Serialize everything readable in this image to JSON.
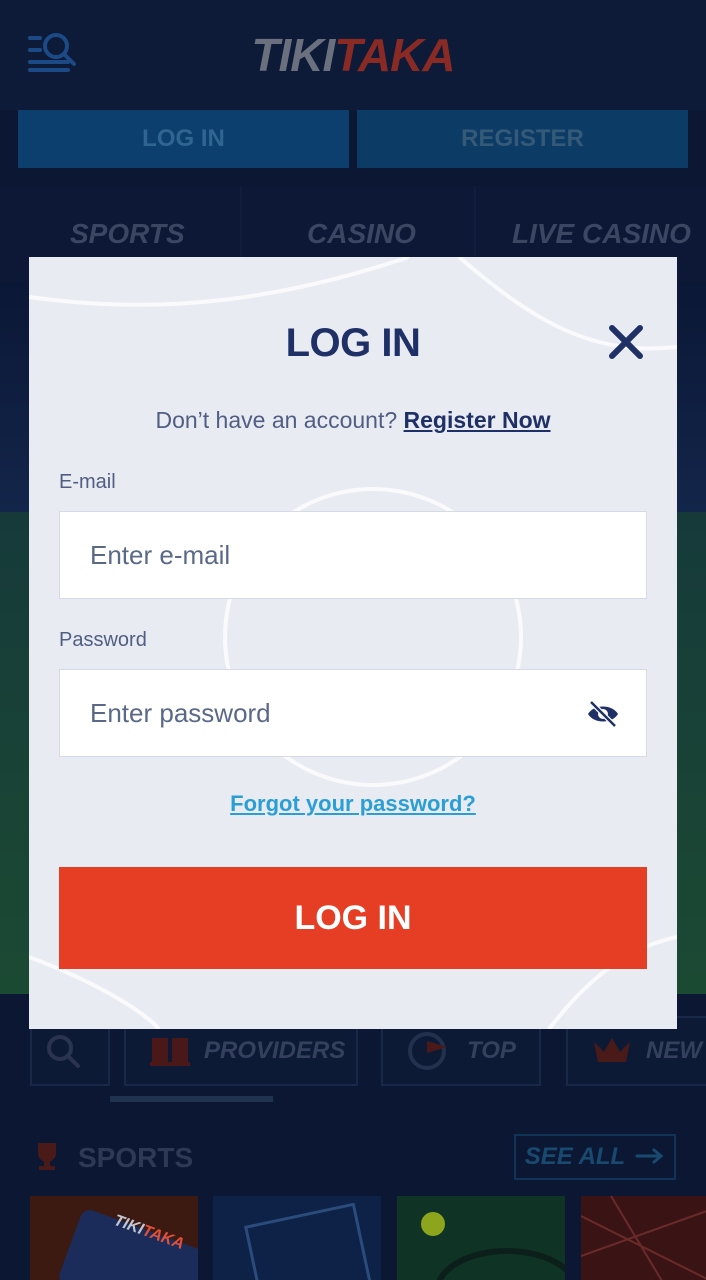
{
  "header": {
    "logo_part1": "TIKI",
    "logo_part2": "TAKA",
    "login_label": "LOG IN",
    "register_label": "REGISTER"
  },
  "categories": [
    "SPORTS",
    "CASINO",
    "LIVE CASINO"
  ],
  "chips": {
    "providers": "PROVIDERS",
    "top": "TOP",
    "new": "NEW"
  },
  "sports_section": {
    "title": "SPORTS",
    "see_all": "SEE ALL"
  },
  "card_logo": {
    "part1": "TIKI",
    "part2": "TAKA"
  },
  "modal": {
    "title": "LOG IN",
    "register_prompt": "Don’t have an account?",
    "register_link": "Register Now",
    "email_label": "E-mail",
    "email_placeholder": "Enter e-mail",
    "password_label": "Password",
    "password_placeholder": "Enter password",
    "forgot_link": "Forgot your password?",
    "submit_label": "LOG IN"
  },
  "colors": {
    "brand_dark": "#1e3066",
    "accent_red": "#e63e24",
    "link_blue": "#2a9fd6",
    "modal_bg": "#e9ebf2"
  }
}
